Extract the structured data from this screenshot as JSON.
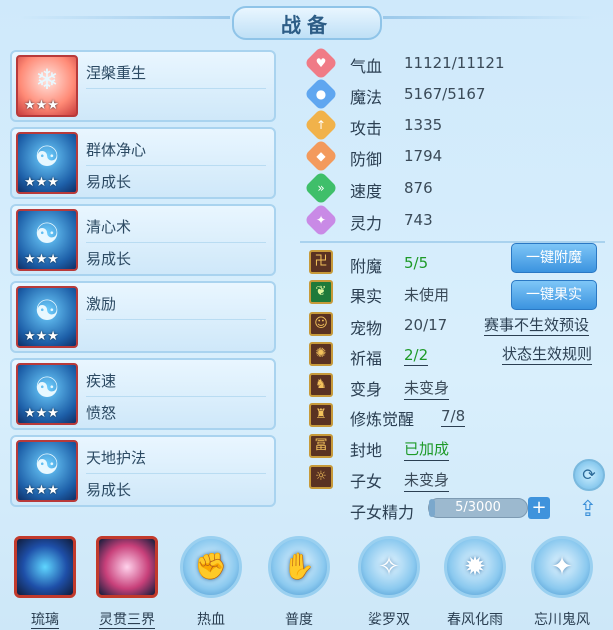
{
  "title": "战备",
  "skills": [
    {
      "name": "涅槃重生",
      "sub": "",
      "stars": "★★★",
      "glyph": "❄"
    },
    {
      "name": "群体净心",
      "sub": "易成长",
      "stars": "★★★",
      "glyph": "☯"
    },
    {
      "name": "清心术",
      "sub": "易成长",
      "stars": "★★★",
      "glyph": "☯"
    },
    {
      "name": "激励",
      "sub": "",
      "stars": "★★★",
      "glyph": "☯"
    },
    {
      "name": "疾速",
      "sub": "愤怒",
      "stars": "★★★",
      "glyph": "☯"
    },
    {
      "name": "天地护法",
      "sub": "易成长",
      "stars": "★★★",
      "glyph": "☯"
    }
  ],
  "stats": [
    {
      "label": "气血",
      "value": "11121/11121",
      "icon": "heart-icon",
      "color": "#f07b86",
      "glyph": "♥"
    },
    {
      "label": "魔法",
      "value": "5167/5167",
      "icon": "mana-icon",
      "color": "#5fa6f0",
      "glyph": "●"
    },
    {
      "label": "攻击",
      "value": "1335",
      "icon": "attack-icon",
      "color": "#f1b24a",
      "glyph": "↑"
    },
    {
      "label": "防御",
      "value": "1794",
      "icon": "defense-icon",
      "color": "#f39a5c",
      "glyph": "◆"
    },
    {
      "label": "速度",
      "value": "876",
      "icon": "speed-icon",
      "color": "#3fbf6a",
      "glyph": "»"
    },
    {
      "label": "灵力",
      "value": "743",
      "icon": "spirit-icon",
      "color": "#c98ae6",
      "glyph": "✦"
    }
  ],
  "rows": [
    {
      "label": "附魔",
      "value": "5/5",
      "green": true,
      "icon": "enchant-icon",
      "glyph": "卍"
    },
    {
      "label": "果实",
      "value": "未使用",
      "green": false,
      "icon": "fruit-icon",
      "glyph": "❦"
    },
    {
      "label": "宠物",
      "value": "20/17",
      "green": false,
      "icon": "pet-avatar-icon",
      "glyph": "☺"
    },
    {
      "label": "祈福",
      "value": "2/2",
      "green": true,
      "underline": true,
      "icon": "blessing-icon",
      "glyph": "✺"
    },
    {
      "label": "变身",
      "value": "未变身",
      "green": false,
      "underline": true,
      "icon": "transform-icon",
      "glyph": "♞"
    },
    {
      "label": "修炼觉醒",
      "value": "7/8",
      "green": false,
      "underline": true,
      "icon": "cultivation-icon",
      "glyph": "♜"
    },
    {
      "label": "封地",
      "value": "已加成",
      "green": true,
      "underline": true,
      "icon": "fief-icon",
      "glyph": "冨"
    },
    {
      "label": "子女",
      "value": "未变身",
      "green": false,
      "underline": true,
      "icon": "child-icon",
      "glyph": "☼"
    }
  ],
  "buttons": {
    "enchant": "一键附魔",
    "fruit": "一键果实"
  },
  "links": {
    "event": "赛事不生效预设",
    "status": "状态生效规则"
  },
  "child_energy": {
    "label": "子女精力",
    "value": "5/3000",
    "fraction": 0.0017
  },
  "bottom": [
    {
      "label": "琉璃",
      "type": "square",
      "underline": true,
      "color": "#1e4fa8",
      "glow": "#5fd6ff"
    },
    {
      "label": "灵贯三界",
      "type": "square",
      "underline": true,
      "color": "#c8407a",
      "glow": "#ffd2ec"
    },
    {
      "label": "热血",
      "type": "round",
      "underline": false,
      "glyph": "✊"
    },
    {
      "label": "普度",
      "type": "round",
      "underline": false,
      "glyph": "✋"
    },
    {
      "label": "娑罗双",
      "type": "round",
      "underline": false,
      "glyph": "✧"
    },
    {
      "label": "春风化雨",
      "type": "round",
      "underline": false,
      "glyph": "✹"
    },
    {
      "label": "忘川鬼风",
      "type": "round",
      "underline": false,
      "glyph": "✦"
    }
  ]
}
